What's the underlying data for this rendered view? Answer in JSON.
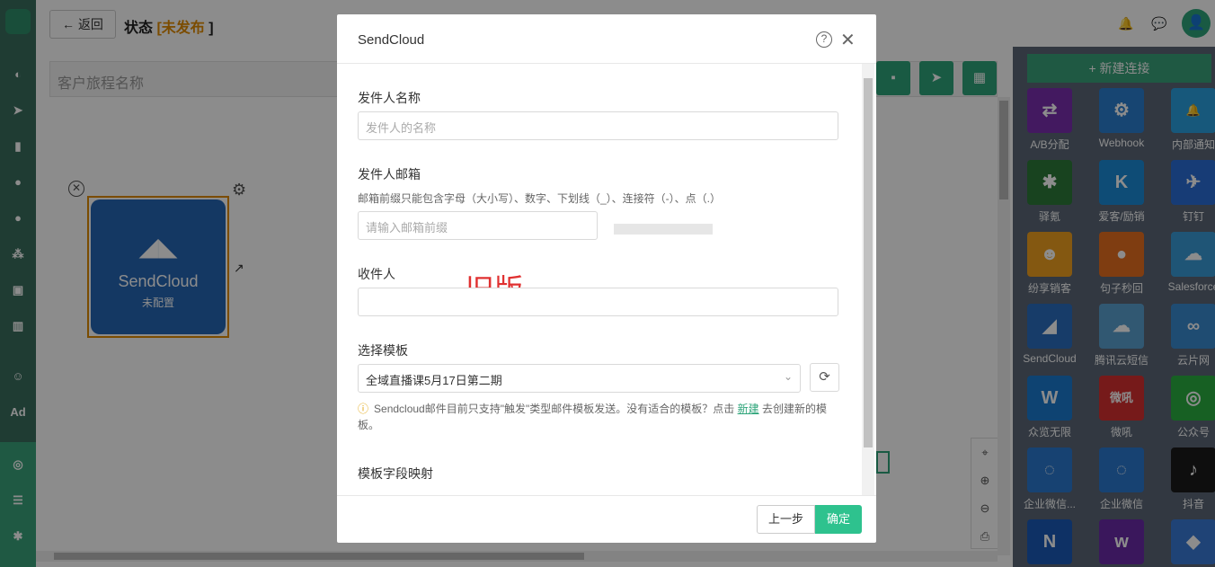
{
  "topbar": {
    "back_label": "返回",
    "status_label": "状态",
    "status_open": "[",
    "status_value": "未发布",
    "status_close": "]"
  },
  "journey": {
    "placeholder": "客户旅程名称"
  },
  "node": {
    "name": "SendCloud",
    "sub": "未配置"
  },
  "right_panel": {
    "add_label": "新建连接",
    "items": [
      {
        "label": "A/B分配",
        "color": "#7a2fb0",
        "glyph": "⇄"
      },
      {
        "label": "Webhook",
        "color": "#2a7ed0",
        "glyph": "⚙"
      },
      {
        "label": "内部通知",
        "color": "#2aa0e0",
        "glyph": "🔔"
      },
      {
        "label": "驿氪",
        "color": "#2c7a3a",
        "glyph": "✱"
      },
      {
        "label": "爱客/励销",
        "color": "#1a8ad8",
        "glyph": "K"
      },
      {
        "label": "钉钉",
        "color": "#2a6ed8",
        "glyph": "✈"
      },
      {
        "label": "纷享销客",
        "color": "#f0a020",
        "glyph": "☻"
      },
      {
        "label": "句子秒回",
        "color": "#e87020",
        "glyph": "●"
      },
      {
        "label": "Salesforce",
        "color": "#3a9bd8",
        "glyph": "☁"
      },
      {
        "label": "SendCloud",
        "color": "#2a6ec0",
        "glyph": "◢"
      },
      {
        "label": "腾讯云短信",
        "color": "#5aa0d0",
        "glyph": "☁"
      },
      {
        "label": "云片网",
        "color": "#3a8ad0",
        "glyph": "∞"
      },
      {
        "label": "众览无限",
        "color": "#1a7ad0",
        "glyph": "W"
      },
      {
        "label": "微吼",
        "color": "#d83030",
        "glyph": "微吼"
      },
      {
        "label": "公众号",
        "color": "#2ab040",
        "glyph": "◎"
      },
      {
        "label": "企业微信...",
        "color": "#2a78d0",
        "glyph": "◌"
      },
      {
        "label": "企业微信",
        "color": "#2a78d0",
        "glyph": "◌"
      },
      {
        "label": "抖音",
        "color": "#1a1a1a",
        "glyph": "♪"
      },
      {
        "label": "",
        "color": "#1a5ab8",
        "glyph": "N"
      },
      {
        "label": "",
        "color": "#6a2aa8",
        "glyph": "w"
      },
      {
        "label": "",
        "color": "#3a7ad8",
        "glyph": "◆"
      }
    ]
  },
  "modal": {
    "title": "SendCloud",
    "sender_name_label": "发件人名称",
    "sender_name_placeholder": "发件人的名称",
    "sender_email_label": "发件人邮箱",
    "sender_email_hint": "邮箱前缀只能包含字母（大小写）、数字、下划线（_）、连接符（-）、点（.）",
    "sender_email_placeholder": "请输入邮箱前缀",
    "recipient_label": "收件人",
    "recipient_value": "",
    "annotation": "旧版",
    "template_label": "选择模板",
    "template_value": "全域直播课5月17日第二期",
    "warning_text": "Sendcloud邮件目前只支持\"触发\"类型邮件模板发送。没有适合的模板？点击 ",
    "warning_link": "新建",
    "warning_tail": " 去创建新的模板。",
    "mapping_label": "模板字段映射",
    "prev_label": "上一步",
    "ok_label": "确定"
  },
  "colors": {
    "brand": "#2ea57a",
    "status": "#e08a00",
    "annotation": "#e03030"
  }
}
